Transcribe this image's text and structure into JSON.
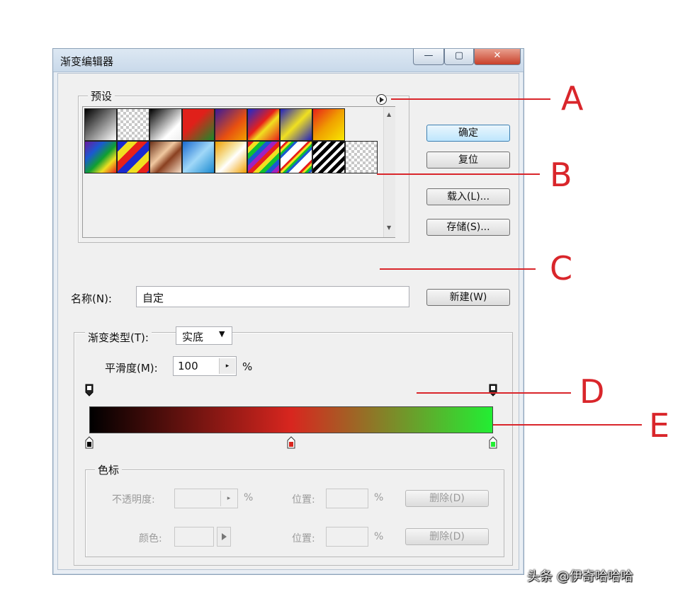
{
  "window": {
    "title": "渐变编辑器",
    "controls": {
      "minimize": "—",
      "maximize": "▢",
      "close": "✕"
    }
  },
  "presets": {
    "legend": "预设",
    "menu_icon": "circle-arrow-icon"
  },
  "buttons": {
    "ok": "确定",
    "reset": "复位",
    "load": "载入(L)...",
    "save": "存储(S)...",
    "new": "新建(W)"
  },
  "name_row": {
    "label": "名称(N):",
    "value": "自定"
  },
  "gradient_type": {
    "label": "渐变类型(T):",
    "value": "实底"
  },
  "smoothness": {
    "label": "平滑度(M):",
    "value": "100",
    "unit": "%"
  },
  "gradient": {
    "colors": [
      "#000000",
      "#d8261f",
      "#22ee33"
    ],
    "color_stops_percent": [
      0,
      50,
      100
    ],
    "opacity_stops_percent": [
      0,
      100
    ]
  },
  "color_stops_group": {
    "legend": "色标",
    "opacity_label": "不透明度:",
    "opacity_unit": "%",
    "color_label": "颜色:",
    "position_label_1": "位置:",
    "position_unit_1": "%",
    "position_label_2": "位置:",
    "position_unit_2": "%",
    "delete_1": "删除(D)",
    "delete_2": "删除(D)"
  },
  "annotations": [
    "A",
    "B",
    "C",
    "D",
    "E"
  ],
  "watermark": "头条 @伊奇哈哈哈",
  "colors": {
    "callout": "#d9262b",
    "default_button": "#bee6fd"
  }
}
